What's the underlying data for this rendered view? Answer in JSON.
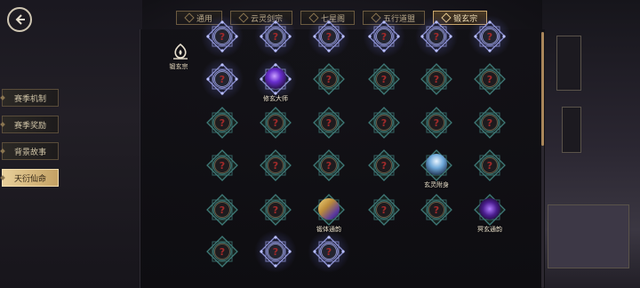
{
  "header": {
    "tabs": [
      {
        "label": "通用",
        "active": false
      },
      {
        "label": "云灵剑宗",
        "active": false
      },
      {
        "label": "七星阁",
        "active": false
      },
      {
        "label": "五行道盟",
        "active": false
      },
      {
        "label": "锻玄宗",
        "active": true
      }
    ]
  },
  "sidebar": {
    "items": [
      {
        "label": "赛季机制",
        "active": false
      },
      {
        "label": "赛季奖励",
        "active": false
      },
      {
        "label": "背景故事",
        "active": false
      },
      {
        "label": "天衍仙命",
        "active": true
      }
    ]
  },
  "section": {
    "label": "锻玄宗"
  },
  "unknown_glyph": "?",
  "talent_nodes": [
    {
      "row": 0,
      "col": 0,
      "state": "locked",
      "style": "lit"
    },
    {
      "row": 0,
      "col": 1,
      "state": "locked",
      "style": "lit"
    },
    {
      "row": 0,
      "col": 2,
      "state": "locked",
      "style": "lit"
    },
    {
      "row": 0,
      "col": 3,
      "state": "locked",
      "style": "lit"
    },
    {
      "row": 0,
      "col": 4,
      "state": "locked",
      "style": "lit"
    },
    {
      "row": 0,
      "col": 5,
      "state": "locked",
      "style": "lit"
    },
    {
      "row": 1,
      "col": 0,
      "state": "locked",
      "style": "lit"
    },
    {
      "row": 1,
      "col": 1,
      "state": "unlocked",
      "style": "lit",
      "label": "修玄大师",
      "art": "purple-storm"
    },
    {
      "row": 1,
      "col": 2,
      "state": "locked",
      "style": "teal"
    },
    {
      "row": 1,
      "col": 3,
      "state": "locked",
      "style": "teal"
    },
    {
      "row": 1,
      "col": 4,
      "state": "locked",
      "style": "teal"
    },
    {
      "row": 1,
      "col": 5,
      "state": "locked",
      "style": "teal"
    },
    {
      "row": 2,
      "col": 0,
      "state": "locked",
      "style": "teal"
    },
    {
      "row": 2,
      "col": 1,
      "state": "locked",
      "style": "teal"
    },
    {
      "row": 2,
      "col": 2,
      "state": "locked",
      "style": "teal"
    },
    {
      "row": 2,
      "col": 3,
      "state": "locked",
      "style": "teal"
    },
    {
      "row": 2,
      "col": 4,
      "state": "locked",
      "style": "teal"
    },
    {
      "row": 2,
      "col": 5,
      "state": "locked",
      "style": "teal"
    },
    {
      "row": 3,
      "col": 0,
      "state": "locked",
      "style": "teal"
    },
    {
      "row": 3,
      "col": 1,
      "state": "locked",
      "style": "teal"
    },
    {
      "row": 3,
      "col": 2,
      "state": "locked",
      "style": "teal"
    },
    {
      "row": 3,
      "col": 3,
      "state": "locked",
      "style": "teal"
    },
    {
      "row": 3,
      "col": 4,
      "state": "unlocked",
      "style": "teal",
      "label": "玄灵附身",
      "art": "blue-sky"
    },
    {
      "row": 3,
      "col": 5,
      "state": "locked",
      "style": "teal"
    },
    {
      "row": 4,
      "col": 0,
      "state": "locked",
      "style": "teal"
    },
    {
      "row": 4,
      "col": 1,
      "state": "locked",
      "style": "teal"
    },
    {
      "row": 4,
      "col": 2,
      "state": "unlocked",
      "style": "teal",
      "label": "锻体通韵",
      "art": "gold-purple"
    },
    {
      "row": 4,
      "col": 3,
      "state": "locked",
      "style": "teal"
    },
    {
      "row": 4,
      "col": 4,
      "state": "locked",
      "style": "teal"
    },
    {
      "row": 4,
      "col": 5,
      "state": "unlocked",
      "style": "teal",
      "label": "冥玄通韵",
      "art": "dark-purple"
    },
    {
      "row": 5,
      "col": 0,
      "state": "locked",
      "style": "teal"
    },
    {
      "row": 5,
      "col": 1,
      "state": "locked",
      "style": "lit"
    },
    {
      "row": 5,
      "col": 2,
      "state": "locked",
      "style": "lit"
    }
  ],
  "colors": {
    "accent": "#c9a56a",
    "lit_frame": "#8f94d6",
    "teal_frame": "#3f7a78",
    "question": "#a12a2a"
  }
}
